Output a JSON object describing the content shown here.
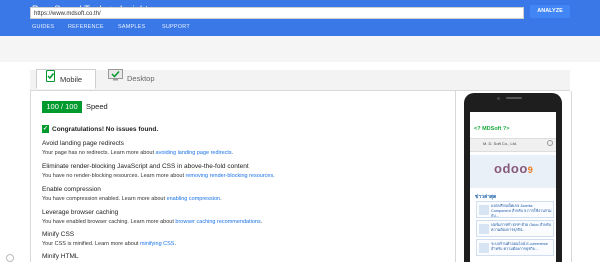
{
  "header": {
    "app": "PageSpeed Tools",
    "separator": ">",
    "section": "Insights",
    "nav": [
      "GUIDES",
      "REFERENCE",
      "SAMPLES",
      "SUPPORT"
    ]
  },
  "url_bar": {
    "value": "https://www.mdsoft.co.th/",
    "analyze_label": "ANALYZE"
  },
  "tabs": [
    {
      "label": "Mobile",
      "active": true
    },
    {
      "label": "Desktop",
      "active": false
    }
  ],
  "score": {
    "value": "100 / 100",
    "label": "Speed",
    "color": "#009a2d"
  },
  "congrats": "Congratulations! No issues found.",
  "rules": [
    {
      "title": "Avoid landing page redirects",
      "text": "Your page has no redirects. Learn more about ",
      "link": "avoiding landing page redirects",
      "after": "."
    },
    {
      "title": "Eliminate render-blocking JavaScript and CSS in above-the-fold content",
      "text": "You have no render-blocking resources. Learn more about ",
      "link": "removing render-blocking resources",
      "after": "."
    },
    {
      "title": "Enable compression",
      "text": "You have compression enabled. Learn more about ",
      "link": "enabling compression",
      "after": "."
    },
    {
      "title": "Leverage browser caching",
      "text": "You have enabled browser caching. Learn more about ",
      "link": "browser caching recommendations",
      "after": "."
    },
    {
      "title": "Minify CSS",
      "text": "Your CSS is minified. Learn more about ",
      "link": "minifying CSS",
      "after": "."
    },
    {
      "title": "Minify HTML",
      "text": "",
      "link": "",
      "after": ""
    }
  ],
  "preview": {
    "brand": "<? MDSoft ?>",
    "company": "M. D. Soft Co., Ltd.",
    "logo": "odoo",
    "logo_version": "9",
    "news_heading": "ข่าวล่าสุด",
    "news": [
      "แจกฟรี!!!แพ็คเกจ Joomla Component สำหรับ 5 การใช้งานร่วมกับ...",
      "ฟอร์มการทำ ERP ด้วย Odoo สำหรับ ความต้องการธุรกิจ...",
      "ระบบร้านค้าออนไลน์ E-commerce สำหรับ ความต้องการธุรกิจ..."
    ]
  },
  "colors": {
    "header_blue": "#3b78e7",
    "accent_blue": "#4285f4",
    "pass_green": "#009a2d"
  }
}
